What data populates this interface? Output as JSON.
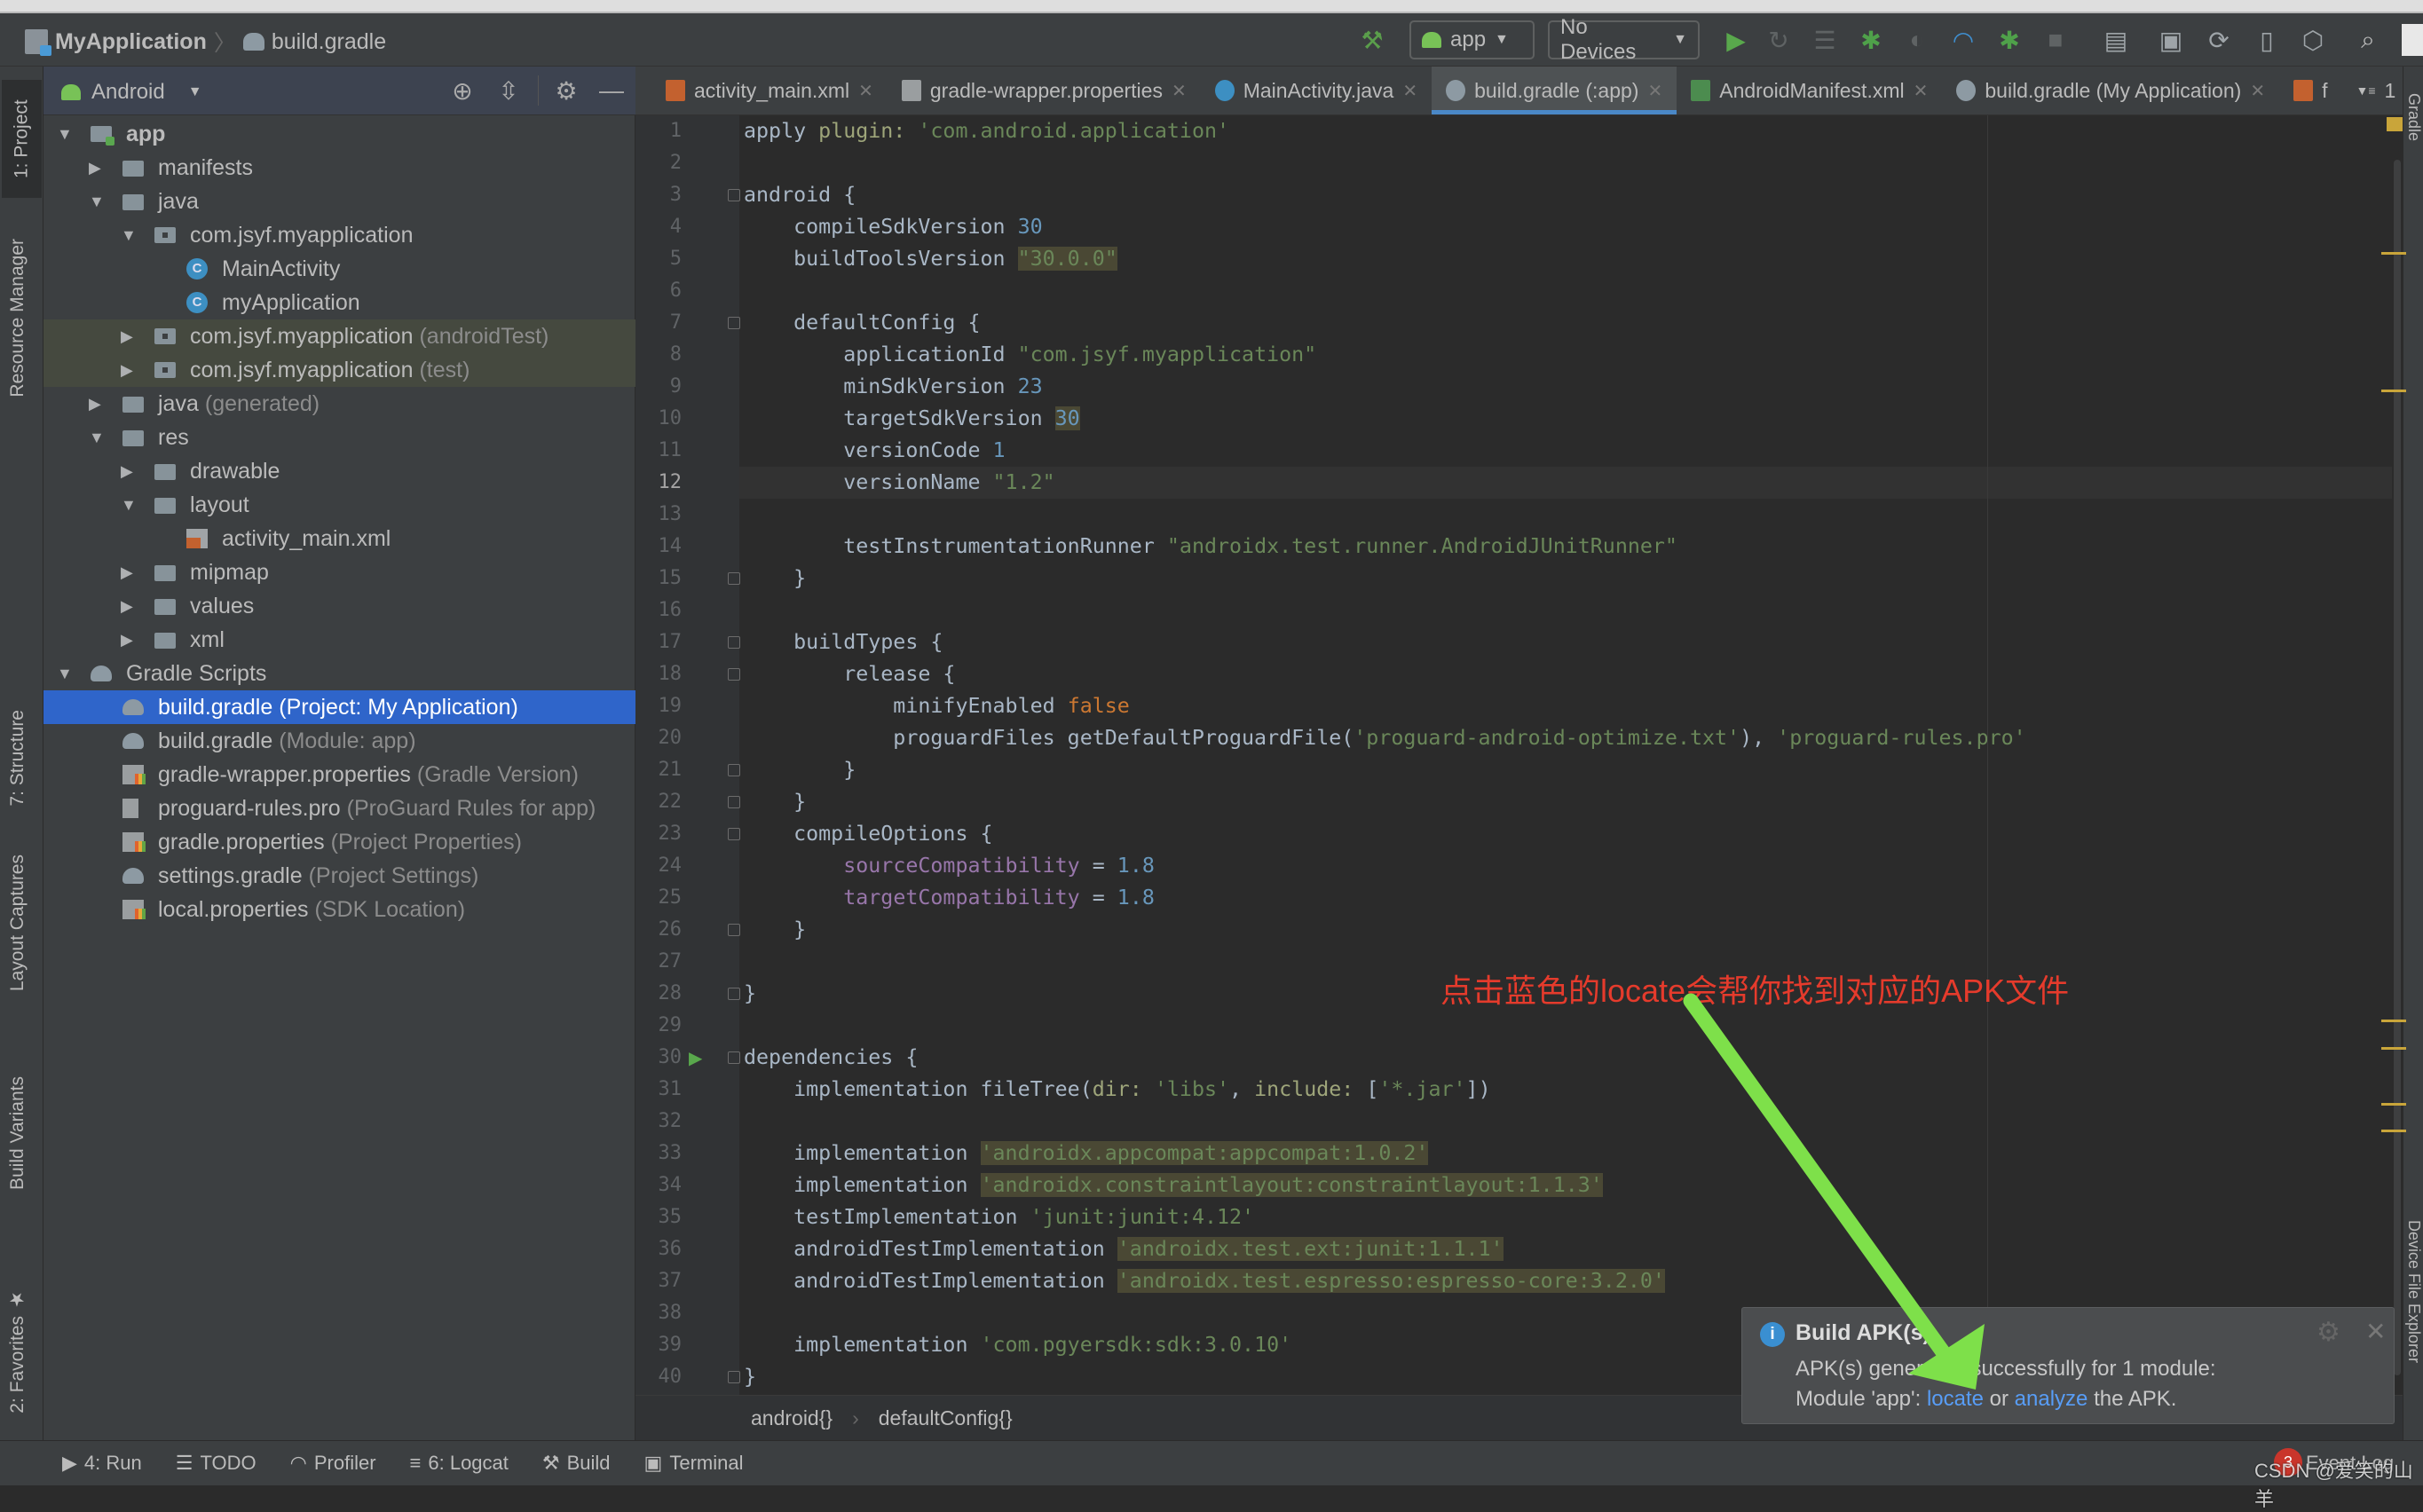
{
  "navbar": {
    "project": "MyApplication",
    "file": "build.gradle",
    "run_config": "app",
    "device": "No Devices",
    "icons": [
      "hammer-icon",
      "run-icon",
      "apply-changes-icon",
      "apply-code-changes-icon",
      "debug-icon",
      "attach-icon",
      "profile-icon",
      "debug-attach-icon",
      "stop-icon",
      "project-structure-icon",
      "terminal-toggle-icon",
      "gradle-sync-icon",
      "avd-manager-icon",
      "sdk-manager-icon",
      "search-icon",
      "avatar-icon"
    ]
  },
  "left_strip": [
    "1: Project",
    "Resource Manager",
    "7: Structure",
    "Layout Captures",
    "Build Variants",
    "2: Favorites"
  ],
  "right_strip": [
    "Gradle",
    "Device File Explorer"
  ],
  "project_panel": {
    "view": "Android",
    "items": [
      {
        "depth": 0,
        "arrow": "open",
        "icon": "module",
        "label": "app",
        "bold": true
      },
      {
        "depth": 1,
        "arrow": "closed",
        "icon": "folder",
        "label": "manifests"
      },
      {
        "depth": 1,
        "arrow": "open",
        "icon": "folder",
        "label": "java"
      },
      {
        "depth": 2,
        "arrow": "open",
        "icon": "package",
        "label": "com.jsyf.myapplication"
      },
      {
        "depth": 3,
        "arrow": "none",
        "icon": "class",
        "label": "MainActivity"
      },
      {
        "depth": 3,
        "arrow": "none",
        "icon": "class",
        "label": "myApplication"
      },
      {
        "depth": 2,
        "arrow": "closed",
        "icon": "package",
        "label": "com.jsyf.myapplication",
        "hint": "(androidTest)",
        "tint": true
      },
      {
        "depth": 2,
        "arrow": "closed",
        "icon": "package",
        "label": "com.jsyf.myapplication",
        "hint": "(test)",
        "tint": true
      },
      {
        "depth": 1,
        "arrow": "closed",
        "icon": "folder",
        "label": "java",
        "hint": "(generated)"
      },
      {
        "depth": 1,
        "arrow": "open",
        "icon": "folder",
        "label": "res"
      },
      {
        "depth": 2,
        "arrow": "closed",
        "icon": "folder",
        "label": "drawable"
      },
      {
        "depth": 2,
        "arrow": "open",
        "icon": "folder",
        "label": "layout"
      },
      {
        "depth": 3,
        "arrow": "none",
        "icon": "xml",
        "label": "activity_main.xml"
      },
      {
        "depth": 2,
        "arrow": "closed",
        "icon": "folder",
        "label": "mipmap"
      },
      {
        "depth": 2,
        "arrow": "closed",
        "icon": "folder",
        "label": "values"
      },
      {
        "depth": 2,
        "arrow": "closed",
        "icon": "folder",
        "label": "xml"
      },
      {
        "depth": 0,
        "arrow": "open",
        "icon": "gradle",
        "label": "Gradle Scripts"
      },
      {
        "depth": 1,
        "arrow": "none",
        "icon": "gradle",
        "label": "build.gradle",
        "hint": "(Project: My Application)",
        "selected": true
      },
      {
        "depth": 1,
        "arrow": "none",
        "icon": "gradle",
        "label": "build.gradle",
        "hint": "(Module: app)"
      },
      {
        "depth": 1,
        "arrow": "none",
        "icon": "props",
        "label": "gradle-wrapper.properties",
        "hint": "(Gradle Version)"
      },
      {
        "depth": 1,
        "arrow": "none",
        "icon": "text",
        "label": "proguard-rules.pro",
        "hint": "(ProGuard Rules for app)"
      },
      {
        "depth": 1,
        "arrow": "none",
        "icon": "props",
        "label": "gradle.properties",
        "hint": "(Project Properties)"
      },
      {
        "depth": 1,
        "arrow": "none",
        "icon": "gradle",
        "label": "settings.gradle",
        "hint": "(Project Settings)"
      },
      {
        "depth": 1,
        "arrow": "none",
        "icon": "props",
        "label": "local.properties",
        "hint": "(SDK Location)"
      }
    ]
  },
  "tabs": [
    {
      "label": "activity_main.xml",
      "icon": "xml"
    },
    {
      "label": "gradle-wrapper.properties",
      "icon": "props"
    },
    {
      "label": "MainActivity.java",
      "icon": "class"
    },
    {
      "label": "build.gradle (:app)",
      "icon": "gradle",
      "active": true
    },
    {
      "label": "AndroidManifest.xml",
      "icon": "manifest"
    },
    {
      "label": "build.gradle (My Application)",
      "icon": "gradle"
    },
    {
      "label": "f",
      "icon": "xml",
      "partial": true
    }
  ],
  "tab_overflow": "1",
  "editor": {
    "current_line": 12,
    "fold_lines": [
      3,
      7,
      15,
      17,
      18,
      21,
      22,
      23,
      26,
      28,
      30,
      40
    ],
    "run_gutter_line": 30,
    "lines": [
      [
        [
          "apply ",
          "t"
        ],
        [
          "plugin: ",
          "a"
        ],
        [
          "'com.android.application'",
          "s"
        ]
      ],
      [],
      [
        [
          "android {",
          "t"
        ]
      ],
      [
        [
          "    compileSdkVersion ",
          "t"
        ],
        [
          "30",
          "n"
        ]
      ],
      [
        [
          "    buildToolsVersion ",
          "t"
        ],
        [
          "\"30.0.0\"",
          "s",
          1
        ]
      ],
      [],
      [
        [
          "    defaultConfig {",
          "t"
        ]
      ],
      [
        [
          "        applicationId ",
          "t"
        ],
        [
          "\"com.jsyf.myapplication\"",
          "s"
        ]
      ],
      [
        [
          "        minSdkVersion ",
          "t"
        ],
        [
          "23",
          "n"
        ]
      ],
      [
        [
          "        targetSdkVersion ",
          "t"
        ],
        [
          "30",
          "n",
          1
        ]
      ],
      [
        [
          "        versionCode ",
          "t"
        ],
        [
          "1",
          "n"
        ]
      ],
      [
        [
          "        versionName ",
          "t"
        ],
        [
          "\"1.2\"",
          "s"
        ]
      ],
      [],
      [
        [
          "        testInstrumentationRunner ",
          "t"
        ],
        [
          "\"androidx.test.runner.AndroidJUnitRunner\"",
          "s"
        ]
      ],
      [
        [
          "    }",
          "t"
        ]
      ],
      [],
      [
        [
          "    buildTypes {",
          "t"
        ]
      ],
      [
        [
          "        release {",
          "t"
        ]
      ],
      [
        [
          "            minifyEnabled ",
          "t"
        ],
        [
          "false",
          "k"
        ]
      ],
      [
        [
          "            proguardFiles getDefaultProguardFile(",
          "t"
        ],
        [
          "'proguard-android-optimize.txt'",
          "s"
        ],
        [
          "), ",
          "t"
        ],
        [
          "'proguard-rules.pro'",
          "s"
        ]
      ],
      [
        [
          "        }",
          "t"
        ]
      ],
      [
        [
          "    }",
          "t"
        ]
      ],
      [
        [
          "    compileOptions {",
          "t"
        ]
      ],
      [
        [
          "        ",
          "t"
        ],
        [
          "sourceCompatibility",
          "p"
        ],
        [
          " = ",
          "t"
        ],
        [
          "1.8",
          "n"
        ]
      ],
      [
        [
          "        ",
          "t"
        ],
        [
          "targetCompatibility",
          "p"
        ],
        [
          " = ",
          "t"
        ],
        [
          "1.8",
          "n"
        ]
      ],
      [
        [
          "    }",
          "t"
        ]
      ],
      [],
      [
        [
          "}",
          "t"
        ]
      ],
      [],
      [
        [
          "dependencies {",
          "t"
        ]
      ],
      [
        [
          "    implementation fileTree(",
          "t"
        ],
        [
          "dir: ",
          "a"
        ],
        [
          "'libs'",
          "s"
        ],
        [
          ", ",
          "t"
        ],
        [
          "include: ",
          "a"
        ],
        [
          "[",
          "t"
        ],
        [
          "'*.jar'",
          "s"
        ],
        [
          "])",
          "t"
        ]
      ],
      [],
      [
        [
          "    implementation ",
          "t"
        ],
        [
          "'androidx.appcompat:appcompat:1.0.2'",
          "s",
          1
        ]
      ],
      [
        [
          "    implementation ",
          "t"
        ],
        [
          "'androidx.constraintlayout:constraintlayout:1.1.3'",
          "s",
          1
        ]
      ],
      [
        [
          "    testImplementation ",
          "t"
        ],
        [
          "'junit:junit:4.12'",
          "s"
        ]
      ],
      [
        [
          "    androidTestImplementation ",
          "t"
        ],
        [
          "'androidx.test.ext:junit:1.1.1'",
          "s",
          1
        ]
      ],
      [
        [
          "    androidTestImplementation ",
          "t"
        ],
        [
          "'androidx.test.espresso:espresso-core:3.2.0'",
          "s",
          1
        ]
      ],
      [],
      [
        [
          "    implementation ",
          "t"
        ],
        [
          "'com.pgyersdk:sdk:3.0.10'",
          "s"
        ]
      ],
      [
        [
          "}",
          "t"
        ]
      ]
    ]
  },
  "breadcrumb": [
    "android{}",
    "defaultConfig{}"
  ],
  "bottom_tools": [
    {
      "label": "4: Run",
      "icon": "run-icon"
    },
    {
      "label": "TODO",
      "icon": "todo-icon"
    },
    {
      "label": "Profiler",
      "icon": "profiler-icon"
    },
    {
      "label": "6: Logcat",
      "icon": "logcat-icon"
    },
    {
      "label": "Build",
      "icon": "hammer-icon"
    },
    {
      "label": "Terminal",
      "icon": "terminal-icon"
    }
  ],
  "event_log": {
    "label": "Event Log",
    "count": "3"
  },
  "notification": {
    "title": "Build APK(s)",
    "line1": "APK(s) generated successfully for 1 module:",
    "line2_prefix": "Module 'app': ",
    "locate": "locate",
    "or": " or ",
    "analyze": "analyze",
    "suffix": " the APK."
  },
  "annotation": "点击蓝色的locate会帮你找到对应的APK文件",
  "watermark": "CSDN @爱笑的山羊",
  "colors": {
    "accent": "#2f65ca",
    "link": "#589df6",
    "annotation": "#e53b2c",
    "arrow": "#7ee04a"
  }
}
